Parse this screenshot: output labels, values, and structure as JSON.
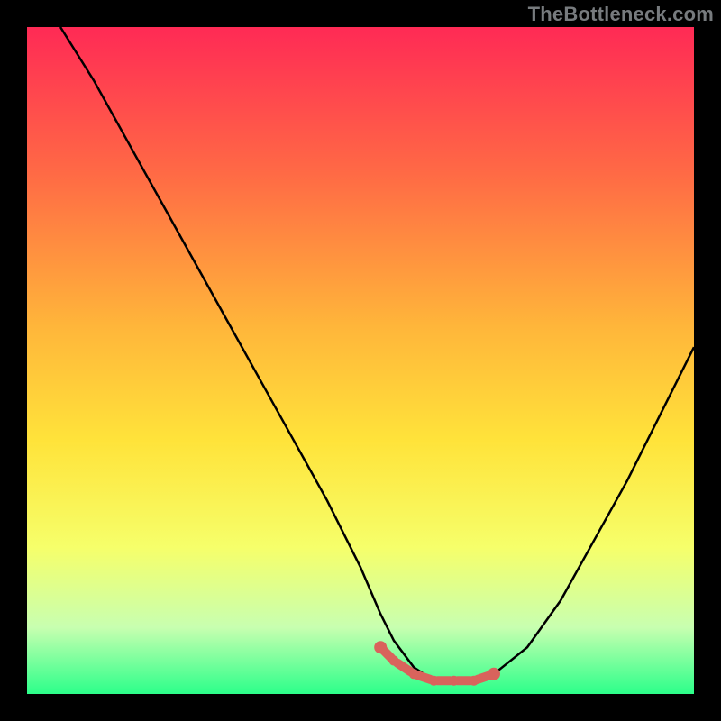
{
  "watermark": "TheBottleneck.com",
  "colors": {
    "top": "#ff2a55",
    "mid_upper": "#ff8a3a",
    "mid": "#ffd83a",
    "mid_lower": "#f6ff6a",
    "lower": "#d8ffb0",
    "bottom": "#2cff8a",
    "curve": "#000000",
    "marker": "#d9635c",
    "frame": "#000000"
  },
  "chart_data": {
    "type": "line",
    "title": "",
    "xlabel": "",
    "ylabel": "",
    "xlim": [
      0,
      100
    ],
    "ylim": [
      0,
      100
    ],
    "series": [
      {
        "name": "curve",
        "x": [
          5,
          10,
          15,
          20,
          25,
          30,
          35,
          40,
          45,
          50,
          53,
          55,
          58,
          61,
          64,
          67,
          70,
          75,
          80,
          85,
          90,
          95,
          100
        ],
        "y": [
          100,
          92,
          83,
          74,
          65,
          56,
          47,
          38,
          29,
          19,
          12,
          8,
          4,
          2,
          2,
          2,
          3,
          7,
          14,
          23,
          32,
          42,
          52
        ]
      }
    ],
    "markers": {
      "name": "optimal-range",
      "x": [
        53,
        55,
        58,
        61,
        64,
        67,
        70
      ],
      "y": [
        7,
        5,
        3,
        2,
        2,
        2,
        3
      ]
    },
    "gradient_stops": [
      {
        "pos": 0.0,
        "color": "#ff2a55"
      },
      {
        "pos": 0.22,
        "color": "#ff6a45"
      },
      {
        "pos": 0.45,
        "color": "#ffb63a"
      },
      {
        "pos": 0.62,
        "color": "#ffe33a"
      },
      {
        "pos": 0.78,
        "color": "#f6ff6a"
      },
      {
        "pos": 0.9,
        "color": "#c8ffb0"
      },
      {
        "pos": 1.0,
        "color": "#2cff8a"
      }
    ]
  }
}
